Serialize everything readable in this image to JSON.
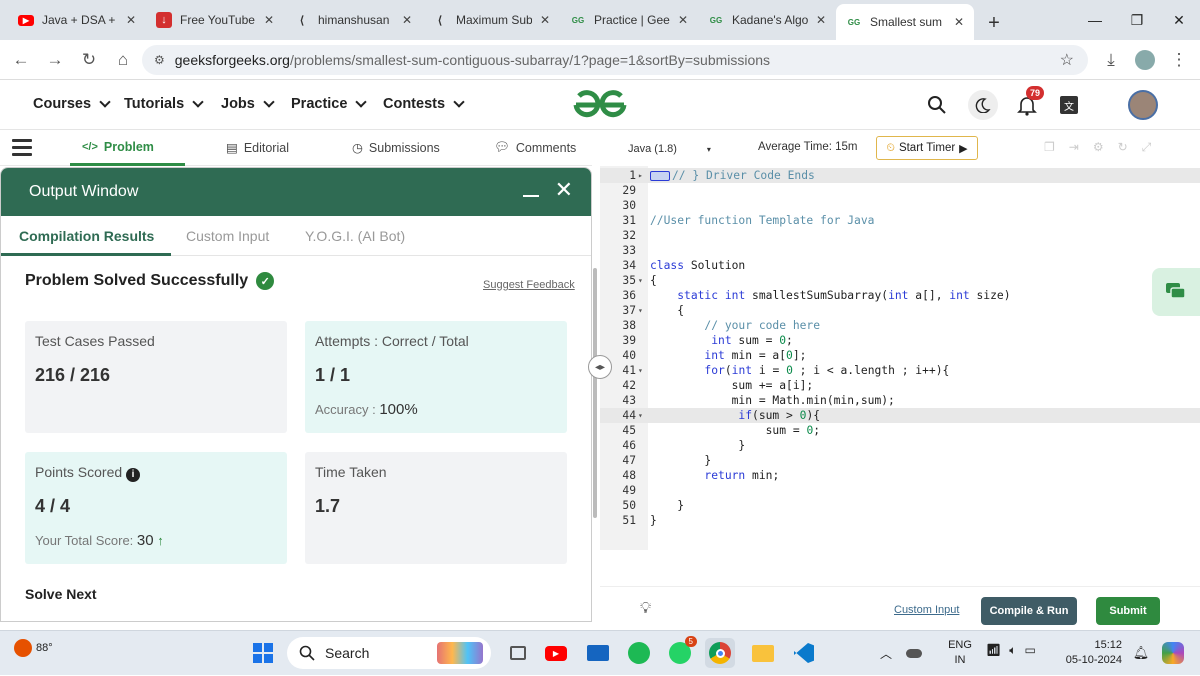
{
  "browser": {
    "tabs": [
      {
        "label": "Java + DSA +",
        "icon": "youtube-icon",
        "color": "#ff0000"
      },
      {
        "label": "Free YouTube",
        "icon": "download-icon",
        "color": "#d32f2f"
      },
      {
        "label": "himanshusan",
        "icon": "gfg-hashnode-icon",
        "color": "#333333"
      },
      {
        "label": "Maximum Sub",
        "icon": "gfg-hashnode-icon",
        "color": "#333333"
      },
      {
        "label": "Practice | Gee",
        "icon": "gfg-icon",
        "color": "#2f8d46"
      },
      {
        "label": "Kadane's Algo",
        "icon": "gfg-icon",
        "color": "#2f8d46"
      },
      {
        "label": "Smallest sum",
        "icon": "gfg-icon",
        "color": "#2f8d46"
      }
    ],
    "url_host": "geeksforgeeks.org",
    "url_path": "/problems/smallest-sum-contiguous-subarray/1?page=1&sortBy=submissions"
  },
  "site_nav": {
    "items": [
      "Courses",
      "Tutorials",
      "Jobs",
      "Practice",
      "Contests"
    ],
    "notification_count": "79"
  },
  "problem_tabs": {
    "problem": "Problem",
    "editorial": "Editorial",
    "submissions": "Submissions",
    "comments": "Comments"
  },
  "output_window": {
    "title": "Output Window",
    "tabs": [
      "Compilation Results",
      "Custom Input",
      "Y.O.G.I. (AI Bot)"
    ],
    "result_title": "Problem Solved Successfully",
    "suggest_feedback": "Suggest Feedback",
    "cards": {
      "test_cases_label": "Test Cases Passed",
      "test_cases_value": "216 / 216",
      "attempts_label": "Attempts : Correct / Total",
      "attempts_value": "1 / 1",
      "accuracy_label": "Accuracy :",
      "accuracy_value": "100%",
      "points_label": "Points Scored",
      "points_value": "4 / 4",
      "total_score_label": "Your Total Score:",
      "total_score_value": "30",
      "time_label": "Time Taken",
      "time_value": "1.7"
    },
    "solve_next": "Solve Next"
  },
  "editor": {
    "language": "Java (1.8)",
    "average_time": "Average Time: 15m",
    "start_timer": "Start Timer",
    "code_lines": [
      {
        "n": "1",
        "fold": "▸",
        "text": "// } Driver Code Ends",
        "hl": true
      },
      {
        "n": "29",
        "fold": "",
        "text": ""
      },
      {
        "n": "30",
        "fold": "",
        "text": ""
      },
      {
        "n": "31",
        "fold": "",
        "text": "//User function Template for Java"
      },
      {
        "n": "32",
        "fold": "",
        "text": ""
      },
      {
        "n": "33",
        "fold": "",
        "text": ""
      },
      {
        "n": "34",
        "fold": "",
        "text": "class Solution"
      },
      {
        "n": "35",
        "fold": "▾",
        "text": "{"
      },
      {
        "n": "36",
        "fold": "",
        "text": "    static int smallestSumSubarray(int a[], int size)"
      },
      {
        "n": "37",
        "fold": "▾",
        "text": "    {"
      },
      {
        "n": "38",
        "fold": "",
        "text": "        // your code here"
      },
      {
        "n": "39",
        "fold": "",
        "text": "         int sum = 0;"
      },
      {
        "n": "40",
        "fold": "",
        "text": "        int min = a[0];"
      },
      {
        "n": "41",
        "fold": "▾",
        "text": "        for(int i = 0 ; i < a.length ; i++){"
      },
      {
        "n": "42",
        "fold": "",
        "text": "            sum += a[i];"
      },
      {
        "n": "43",
        "fold": "",
        "text": "            min = Math.min(min,sum);"
      },
      {
        "n": "44",
        "fold": "▾",
        "text": "             if(sum > 0){",
        "hl": true
      },
      {
        "n": "45",
        "fold": "",
        "text": "                 sum = 0;"
      },
      {
        "n": "46",
        "fold": "",
        "text": "             }"
      },
      {
        "n": "47",
        "fold": "",
        "text": "        }"
      },
      {
        "n": "48",
        "fold": "",
        "text": "        return min;"
      },
      {
        "n": "49",
        "fold": "",
        "text": ""
      },
      {
        "n": "50",
        "fold": "",
        "text": "    }"
      },
      {
        "n": "51",
        "fold": "",
        "text": "}"
      }
    ],
    "custom_input": "Custom Input",
    "compile_run": "Compile & Run",
    "submit": "Submit"
  },
  "taskbar": {
    "weather": "88°",
    "search": "Search",
    "whatsapp_badge": "5",
    "lang_top": "ENG",
    "lang_bottom": "IN",
    "time": "15:12",
    "date": "05-10-2024"
  }
}
